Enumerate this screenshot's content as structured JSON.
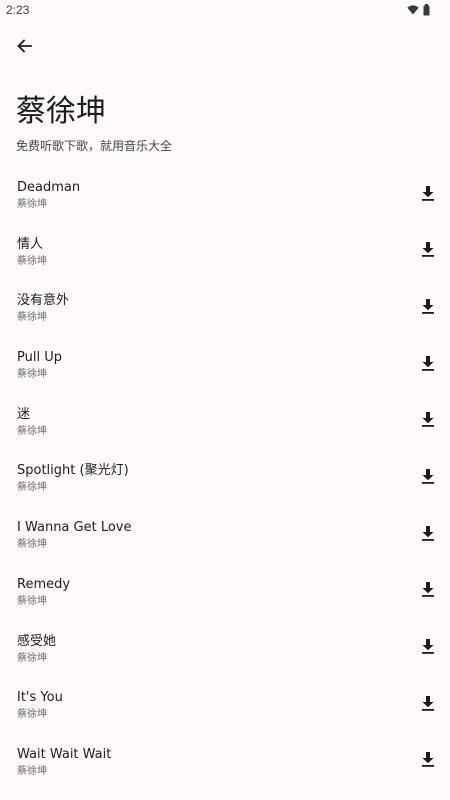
{
  "status_bar": {
    "time": "2:23"
  },
  "header": {
    "title": "蔡徐坤",
    "subtitle": "免费听歌下歌，就用音乐大全"
  },
  "songs": [
    {
      "title": "Deadman",
      "artist": "蔡徐坤"
    },
    {
      "title": "情人",
      "artist": "蔡徐坤"
    },
    {
      "title": "没有意外",
      "artist": "蔡徐坤"
    },
    {
      "title": "Pull Up",
      "artist": "蔡徐坤"
    },
    {
      "title": "迷",
      "artist": "蔡徐坤"
    },
    {
      "title": "Spotlight (聚光灯)",
      "artist": "蔡徐坤"
    },
    {
      "title": "I Wanna Get Love",
      "artist": "蔡徐坤"
    },
    {
      "title": "Remedy",
      "artist": "蔡徐坤"
    },
    {
      "title": "感受她",
      "artist": "蔡徐坤"
    },
    {
      "title": "It's You",
      "artist": "蔡徐坤"
    },
    {
      "title": "Wait Wait Wait",
      "artist": "蔡徐坤"
    }
  ],
  "icons": {
    "back": "arrow-back-icon",
    "download": "download-icon",
    "wifi": "wifi-icon",
    "battery": "battery-icon"
  },
  "colors": {
    "background": "#fdf9fd",
    "text_primary": "#1d1b1f",
    "text_secondary": "#6b6970"
  }
}
